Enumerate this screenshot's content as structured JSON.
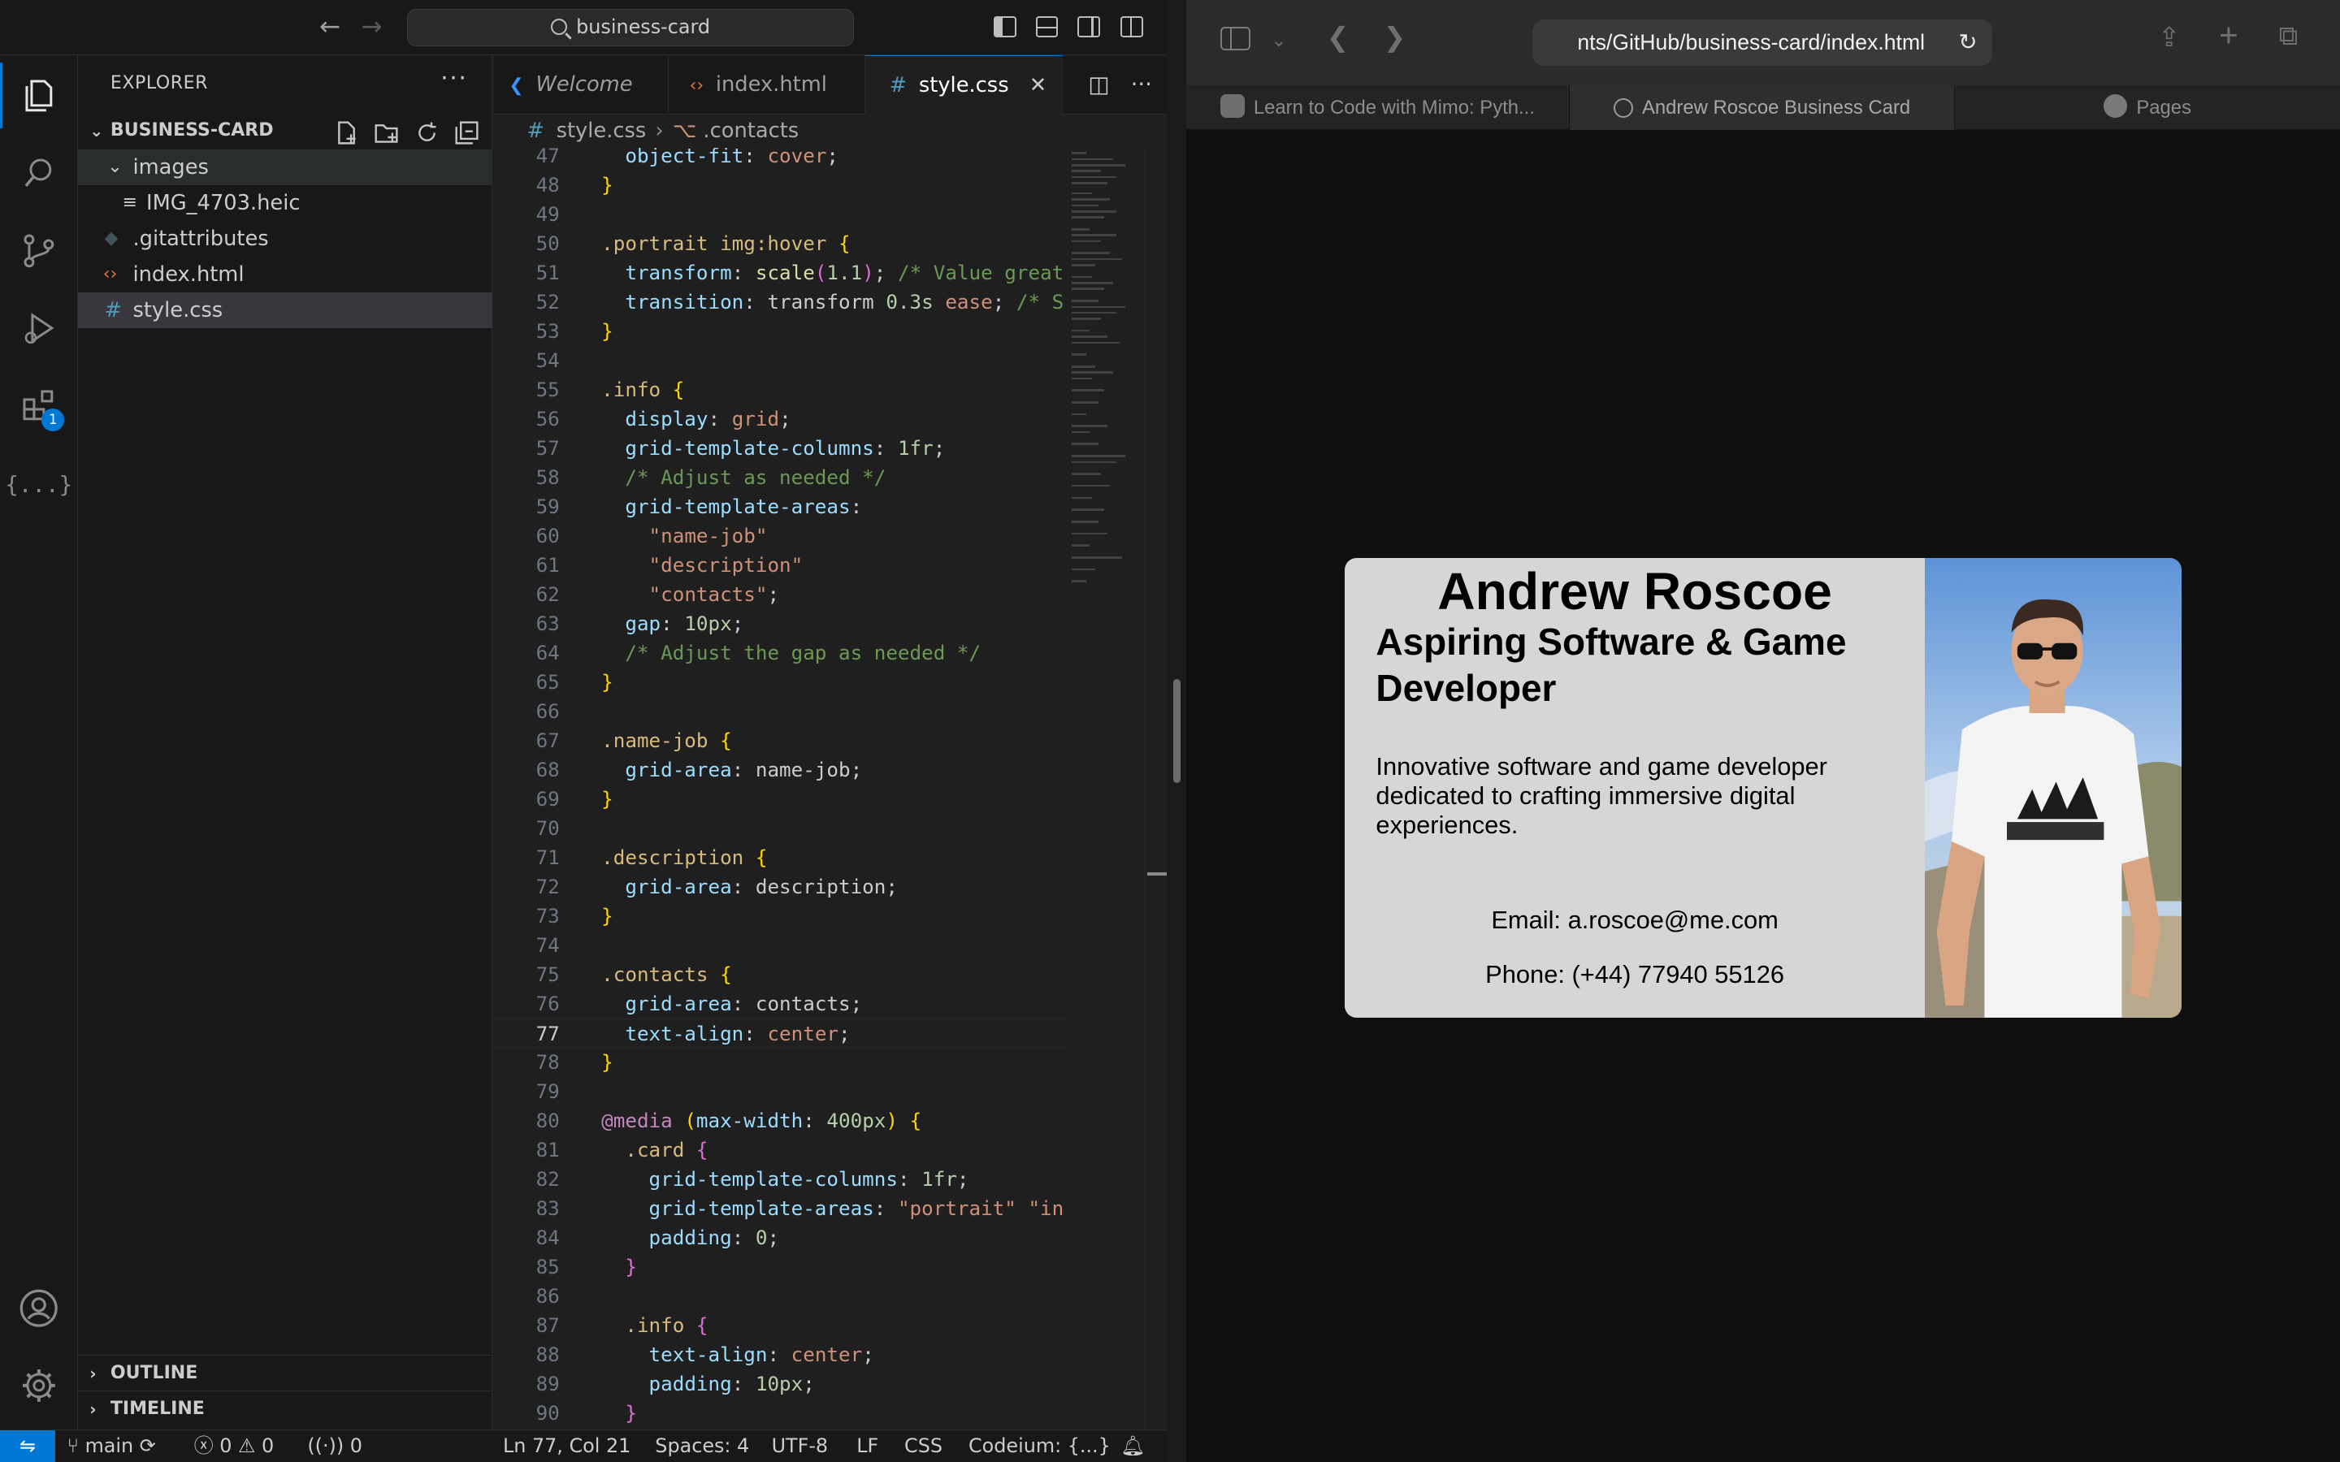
{
  "vscode": {
    "title_search": "business-card",
    "explorer_title": "EXPLORER",
    "activity_badge": "1",
    "project_name": "BUSINESS-CARD",
    "tree": [
      {
        "name": "images",
        "type": "folder"
      },
      {
        "name": "IMG_4703.heic",
        "type": "file"
      },
      {
        "name": ".gitattributes",
        "type": "file"
      },
      {
        "name": "index.html",
        "type": "file"
      },
      {
        "name": "style.css",
        "type": "file"
      }
    ],
    "outline_label": "OUTLINE",
    "timeline_label": "TIMELINE",
    "tabs": [
      {
        "label": "Welcome"
      },
      {
        "label": "index.html"
      },
      {
        "label": "style.css"
      }
    ],
    "breadcrumb": {
      "file": "style.css",
      "symbol": ".contacts"
    },
    "status": {
      "branch": "main",
      "errors": "0",
      "warnings": "0",
      "ports": "0",
      "position": "Ln 77, Col 21",
      "spaces": "Spaces: 4",
      "encoding": "UTF-8",
      "eol": "LF",
      "language": "CSS",
      "codeium": "Codeium: {...}"
    }
  },
  "safari": {
    "address": "nts/GitHub/business-card/index.html",
    "tabs": [
      {
        "label": "Learn to Code with Mimo: Pyth..."
      },
      {
        "label": "Andrew Roscoe Business Card"
      },
      {
        "label": "Pages"
      }
    ],
    "card": {
      "name": "Andrew Roscoe",
      "job": "Aspiring Software & Game Developer",
      "description": "Innovative software and game developer dedicated to crafting immersive digital experiences.",
      "email": "Email: a.roscoe@me.com",
      "phone": "Phone: (+44) 77940 55126"
    }
  }
}
